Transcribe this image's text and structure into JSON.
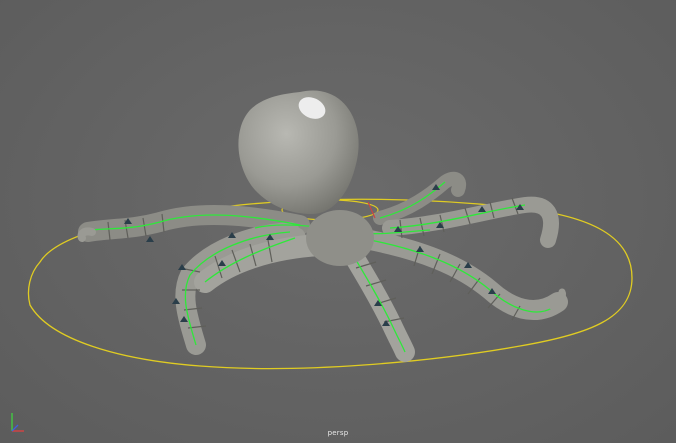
{
  "viewport": {
    "camera_label": "persp",
    "background_color": "#636363"
  },
  "scene": {
    "object": "octopus-mesh",
    "body_color": "#9a9a94",
    "skin_shadow_color": "#6f6f69",
    "rig_control_color": "#2ee83a",
    "ground_control_color": "#e0cc22",
    "eye_color": "#ededed"
  },
  "axis_gizmo": {
    "x_color": "#e04040",
    "y_color": "#40d040",
    "z_color": "#4060e0"
  }
}
